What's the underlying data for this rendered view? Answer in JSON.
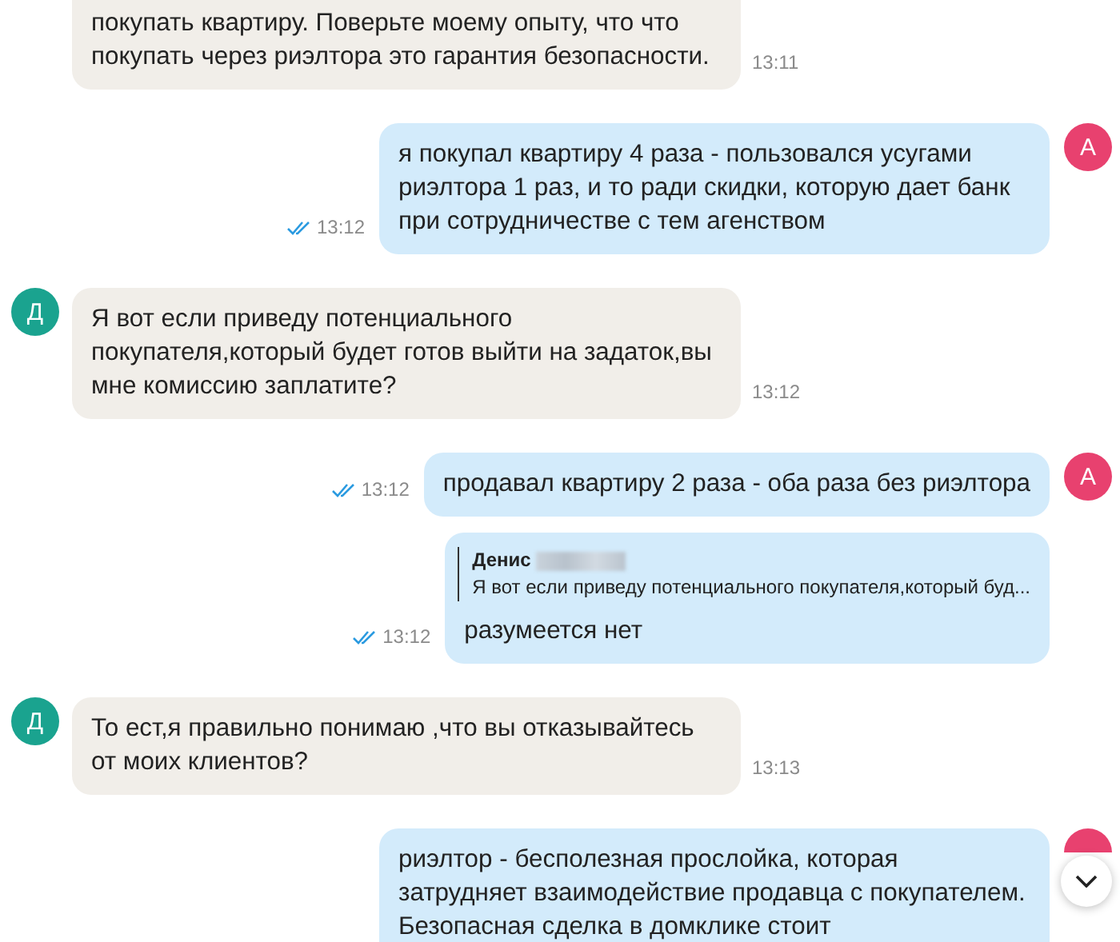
{
  "messages": [
    {
      "kind": "incoming",
      "cut_top": true,
      "avatar_shown": false,
      "text": "покупать квартиру. Поверьте моему опыту, что что покупать через риэлтора это гарантия безопасности.",
      "time": "13:11"
    },
    {
      "kind": "outgoing",
      "avatar_shown": true,
      "avatar_letter": "А",
      "text": "я покупал квартиру 4 раза - пользовался усугами риэлтора 1 раз, и то ради скидки, которую дает банк при сотрудничестве с тем агенством",
      "time": "13:12",
      "read": true
    },
    {
      "kind": "incoming",
      "avatar_shown": true,
      "avatar_letter": "Д",
      "text": "Я вот если приведу потенциального покупателя,который будет готов выйти на задаток,вы мне комиссию заплатите?",
      "time": "13:12"
    },
    {
      "kind": "outgoing",
      "avatar_shown": true,
      "avatar_letter": "А",
      "text": "продавал квартиру 2 раза - оба раза без риэлтора",
      "time": "13:12",
      "read": true
    },
    {
      "kind": "outgoing",
      "avatar_shown": false,
      "reply": {
        "author": "Денис",
        "redacted": true,
        "text": "Я вот если приведу потенциального покупателя,который буд..."
      },
      "text": "разумеется нет",
      "time": "13:12",
      "read": true
    },
    {
      "kind": "incoming",
      "avatar_shown": true,
      "avatar_letter": "Д",
      "text": "То ест,я правильно понимаю ,что вы отказывайтесь от моих клиентов?",
      "time": "13:13"
    },
    {
      "kind": "outgoing",
      "avatar_shown": true,
      "cut_bottom": true,
      "text": "риэлтор - бесполезная прослойка, которая затрудняет взаимодействие продавца с покупателем. Безопасная сделка в домклике стоит"
    }
  ]
}
